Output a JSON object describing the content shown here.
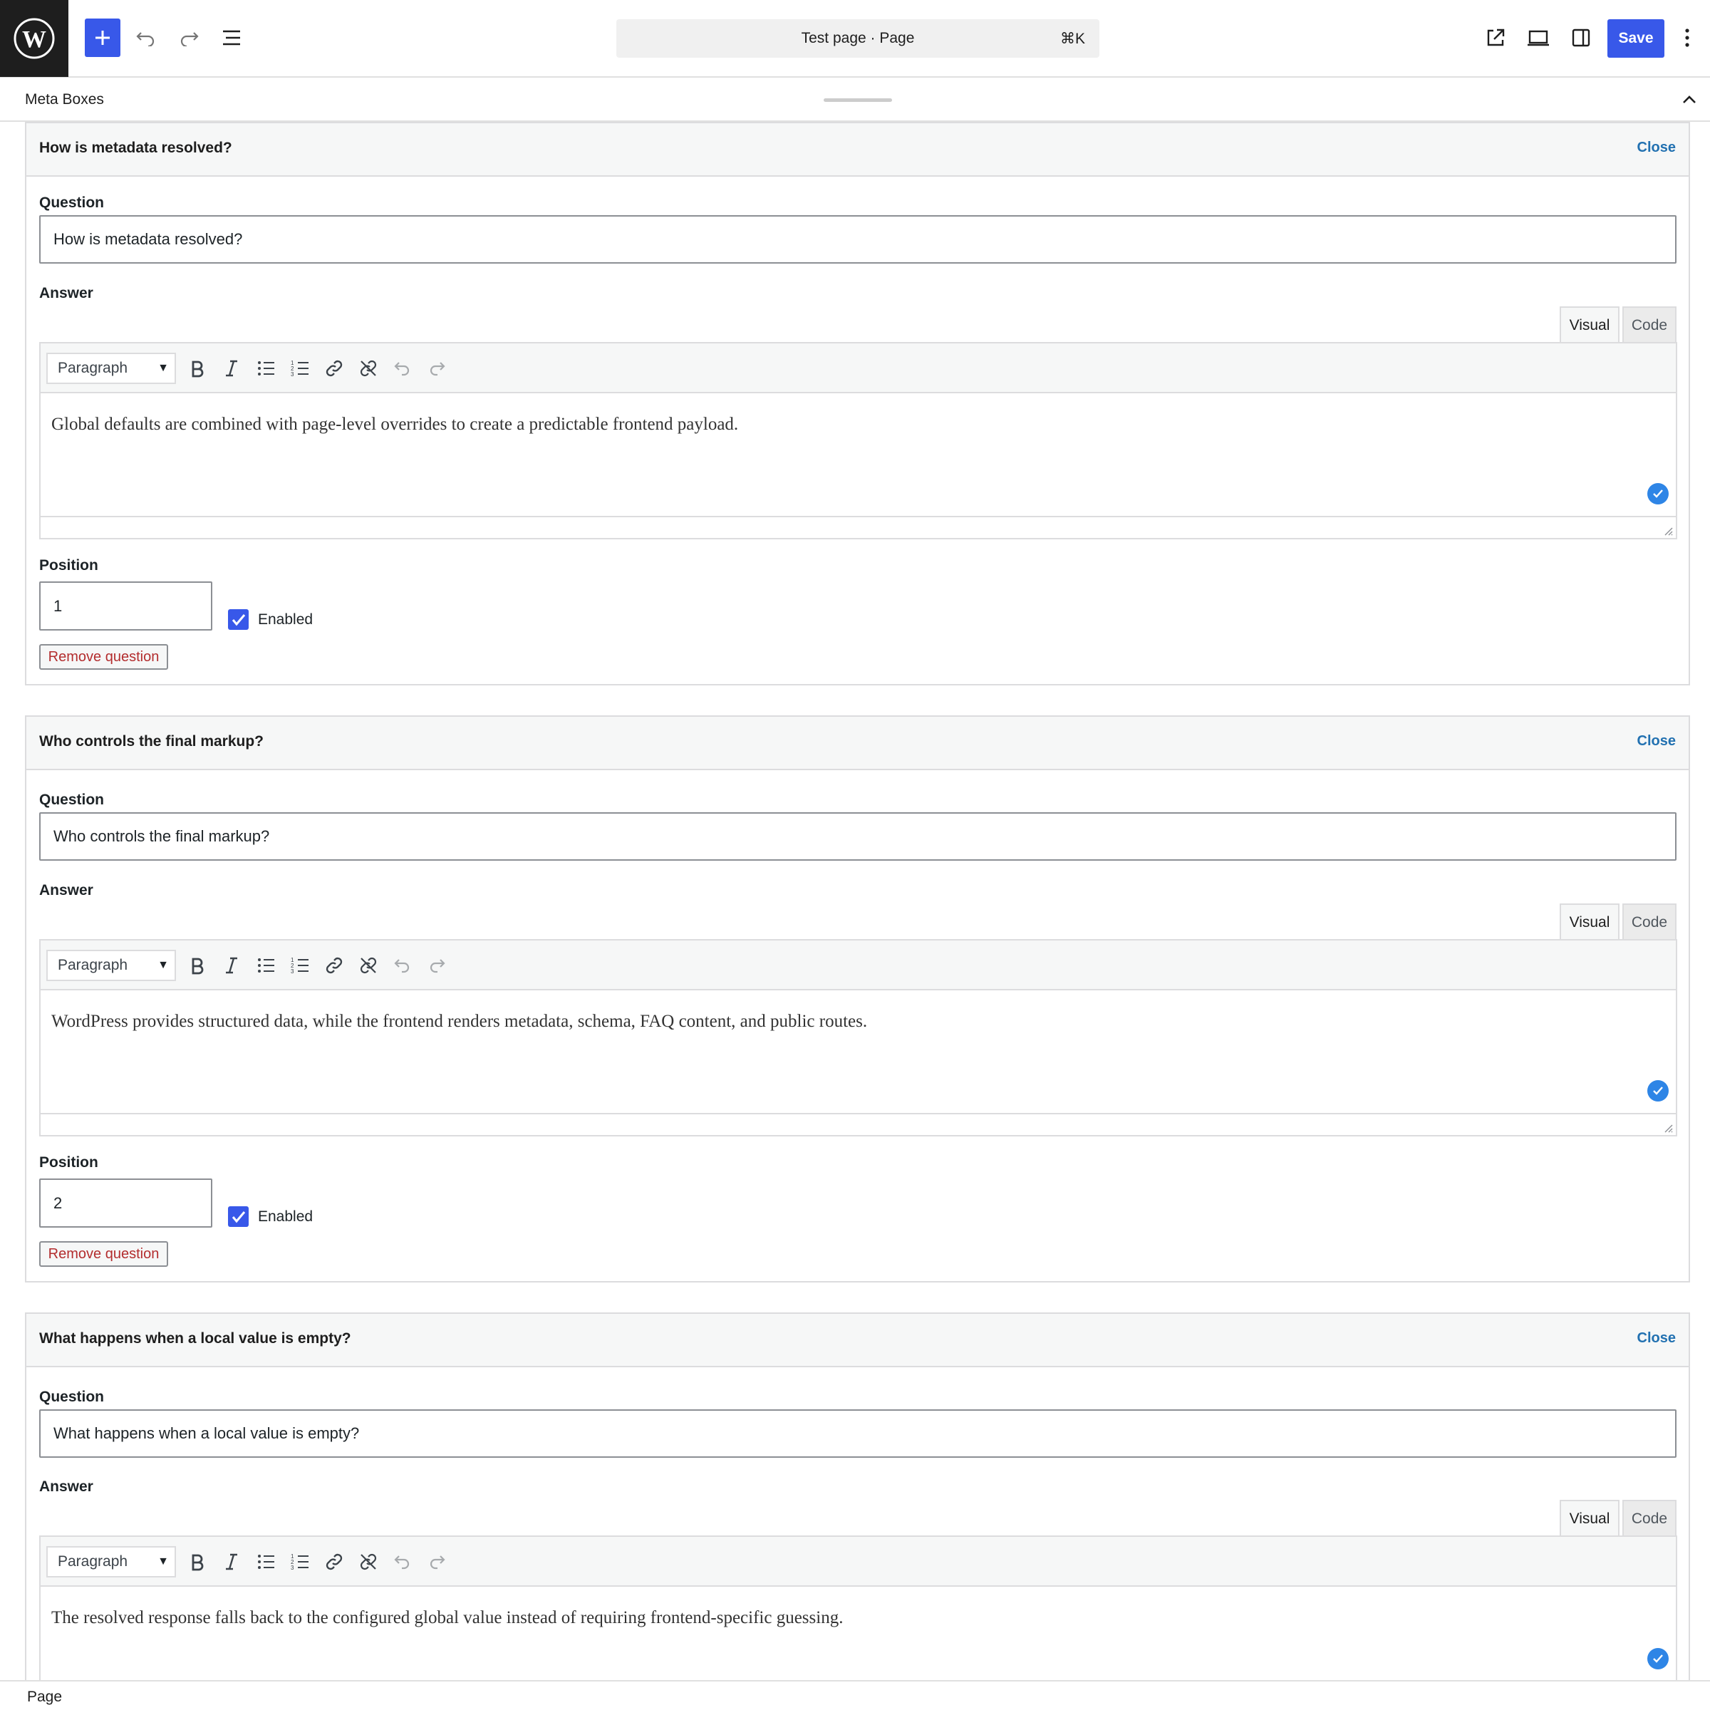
{
  "header": {
    "document_title": "Test page · Page",
    "shortcut": "⌘K",
    "save_label": "Save"
  },
  "meta_boxes": {
    "title": "Meta Boxes"
  },
  "labels": {
    "question": "Question",
    "answer": "Answer",
    "position": "Position",
    "enabled": "Enabled",
    "remove": "Remove question",
    "close": "Close",
    "visual_tab": "Visual",
    "code_tab": "Code",
    "format": "Paragraph"
  },
  "faq": [
    {
      "title": "How is metadata resolved?",
      "question": "How is metadata resolved?",
      "answer": "Global defaults are combined with page-level overrides to create a predictable frontend payload.",
      "position": "1",
      "enabled": true
    },
    {
      "title": "Who controls the final markup?",
      "question": "Who controls the final markup?",
      "answer": "WordPress provides structured data, while the frontend renders metadata, schema, FAQ content, and public routes.",
      "position": "2",
      "enabled": true
    },
    {
      "title": "What happens when a local value is empty?",
      "question": "What happens when a local value is empty?",
      "answer": "The resolved response falls back to the configured global value instead of requiring frontend-specific guessing."
    }
  ],
  "footer": {
    "breadcrumb": "Page"
  },
  "colors": {
    "accent": "#3858e9",
    "link": "#2271b1",
    "danger": "#b32d2e"
  }
}
